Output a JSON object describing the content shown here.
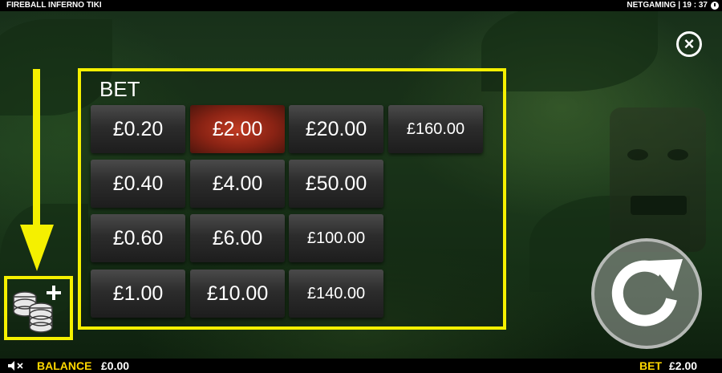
{
  "game": {
    "title": "FIREBALL INFERNO TIKI",
    "provider_time": "NETGAMING | 19 : 37"
  },
  "panel": {
    "title": "BET",
    "options": [
      {
        "label": "£0.20",
        "selected": false
      },
      {
        "label": "£2.00",
        "selected": true
      },
      {
        "label": "£20.00",
        "selected": false
      },
      {
        "label": "£160.00",
        "selected": false
      },
      {
        "label": "£0.40",
        "selected": false
      },
      {
        "label": "£4.00",
        "selected": false
      },
      {
        "label": "£50.00",
        "selected": false
      },
      {
        "label": "£0.60",
        "selected": false
      },
      {
        "label": "£6.00",
        "selected": false
      },
      {
        "label": "£100.00",
        "selected": false
      },
      {
        "label": "£1.00",
        "selected": false
      },
      {
        "label": "£10.00",
        "selected": false
      },
      {
        "label": "£140.00",
        "selected": false
      }
    ]
  },
  "footer": {
    "balance_label": "BALANCE",
    "balance_value": "£0.00",
    "bet_label": "BET",
    "bet_value": "£2.00"
  },
  "close_symbol": "×",
  "colors": {
    "highlight": "#f5f000",
    "selected_bet": "#a8301c",
    "label_yellow": "#ffd800"
  },
  "icons": [
    "clock-icon",
    "close-icon",
    "sound-muted-icon",
    "coins-plus-icon",
    "spin-icon",
    "arrow-down-icon"
  ]
}
